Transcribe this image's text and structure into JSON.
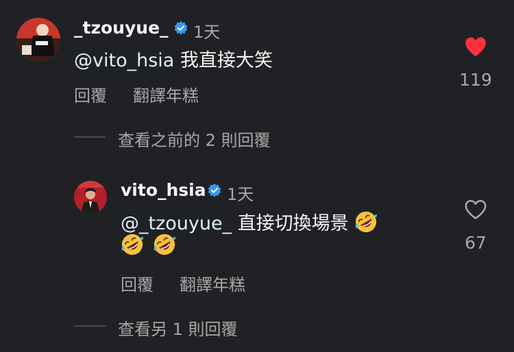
{
  "comment": {
    "username": "_tzouyue_",
    "time": "1天",
    "mention": "@vito_hsia",
    "body": "我直接大笑",
    "reply_label": "回覆",
    "translate_label": "翻譯年糕",
    "likes": "119",
    "liked": true
  },
  "view_previous": "查看之前的 2 則回覆",
  "reply": {
    "username": "vito_hsia",
    "time": "1天",
    "mention": "@_tzouyue_",
    "body": "直接切換場景",
    "emoji": "rofl",
    "reply_label": "回覆",
    "translate_label": "翻譯年糕",
    "likes": "67",
    "liked": false
  },
  "view_more": "查看另 1 則回覆",
  "colors": {
    "background": "#202124",
    "text": "#f5f5f5",
    "secondary": "#a8a8a8",
    "mention": "#e0f1ff",
    "verified": "#3897f0",
    "heart": "#ff3040"
  }
}
